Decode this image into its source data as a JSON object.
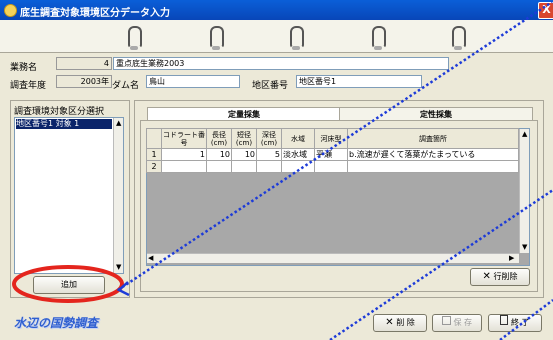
{
  "window": {
    "title": "底生調査対象環境区分データ入力",
    "close": "X"
  },
  "header": {
    "gyomu_label": "業務名",
    "gyomu_no": "4",
    "gyomu_name": "重点底生業務2003",
    "nendo_label": "調査年度",
    "nendo_value": "2003年",
    "dam_label": "ダム名",
    "dam_value": "鳥山",
    "chiku_label": "地区番号",
    "chiku_value": "地区番号1"
  },
  "left_panel": {
    "title": "調査環境対象区分選択",
    "items": [
      {
        "label": "地区番号1 対象 1"
      }
    ],
    "add_button": "追加"
  },
  "tabs": {
    "active": "定量採集",
    "inactive": "定性採集"
  },
  "grid": {
    "headers": [
      "コドラート番号",
      "長径(cm)",
      "短径(cm)",
      "深径(cm)",
      "水域",
      "河床型",
      "調査箇所"
    ],
    "rows": [
      {
        "no": "1",
        "cells": [
          "1",
          "10",
          "10",
          "5",
          "淡水域",
          "平瀬",
          "b.流速が遅くて落葉がたまっている"
        ]
      },
      {
        "no": "2",
        "cells": [
          "",
          "",
          "",
          "",
          "",
          "",
          ""
        ]
      }
    ],
    "row_delete_button": "行削除"
  },
  "footer": {
    "logo_text": "水辺の国勢調査",
    "delete_button": "削 除",
    "save_button": "保 存",
    "close_button": "終 了"
  },
  "colors": {
    "accent": "#0a5fd8",
    "annotation": "#e4251d",
    "arrow": "#1d3bd8"
  }
}
